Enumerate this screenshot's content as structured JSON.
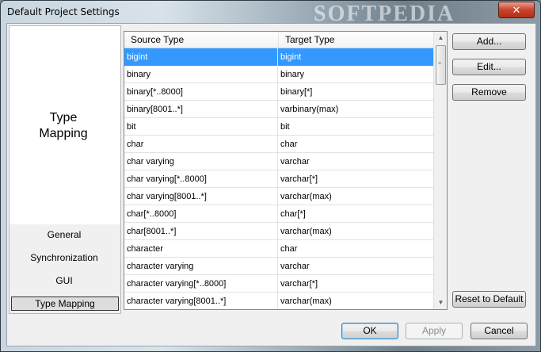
{
  "window": {
    "title": "Default Project Settings",
    "watermark": "SOFTPEDIA",
    "close_glyph": "✕"
  },
  "nav": {
    "heading_line1": "Type",
    "heading_line2": "Mapping",
    "items": [
      {
        "label": "General"
      },
      {
        "label": "Synchronization"
      },
      {
        "label": "GUI"
      },
      {
        "label": "Type Mapping",
        "selected": true
      }
    ]
  },
  "grid": {
    "columns": [
      "Source Type",
      "Target Type"
    ],
    "rows": [
      {
        "source": "bigint",
        "target": "bigint",
        "selected": true
      },
      {
        "source": "binary",
        "target": "binary"
      },
      {
        "source": "binary[*..8000]",
        "target": "binary[*]"
      },
      {
        "source": "binary[8001..*]",
        "target": "varbinary(max)"
      },
      {
        "source": "bit",
        "target": "bit"
      },
      {
        "source": "char",
        "target": "char"
      },
      {
        "source": "char varying",
        "target": "varchar"
      },
      {
        "source": "char varying[*..8000]",
        "target": "varchar[*]"
      },
      {
        "source": "char varying[8001..*]",
        "target": "varchar(max)"
      },
      {
        "source": "char[*..8000]",
        "target": "char[*]"
      },
      {
        "source": "char[8001..*]",
        "target": "varchar(max)"
      },
      {
        "source": "character",
        "target": "char"
      },
      {
        "source": "character varying",
        "target": "varchar"
      },
      {
        "source": "character varying[*..8000]",
        "target": "varchar[*]"
      },
      {
        "source": "character varying[8001..*]",
        "target": "varchar(max)"
      }
    ]
  },
  "buttons": {
    "add": "Add...",
    "edit": "Edit...",
    "remove": "Remove",
    "reset": "Reset to Default",
    "ok": "OK",
    "apply": "Apply",
    "cancel": "Cancel"
  },
  "colors": {
    "selection": "#3399ff"
  }
}
